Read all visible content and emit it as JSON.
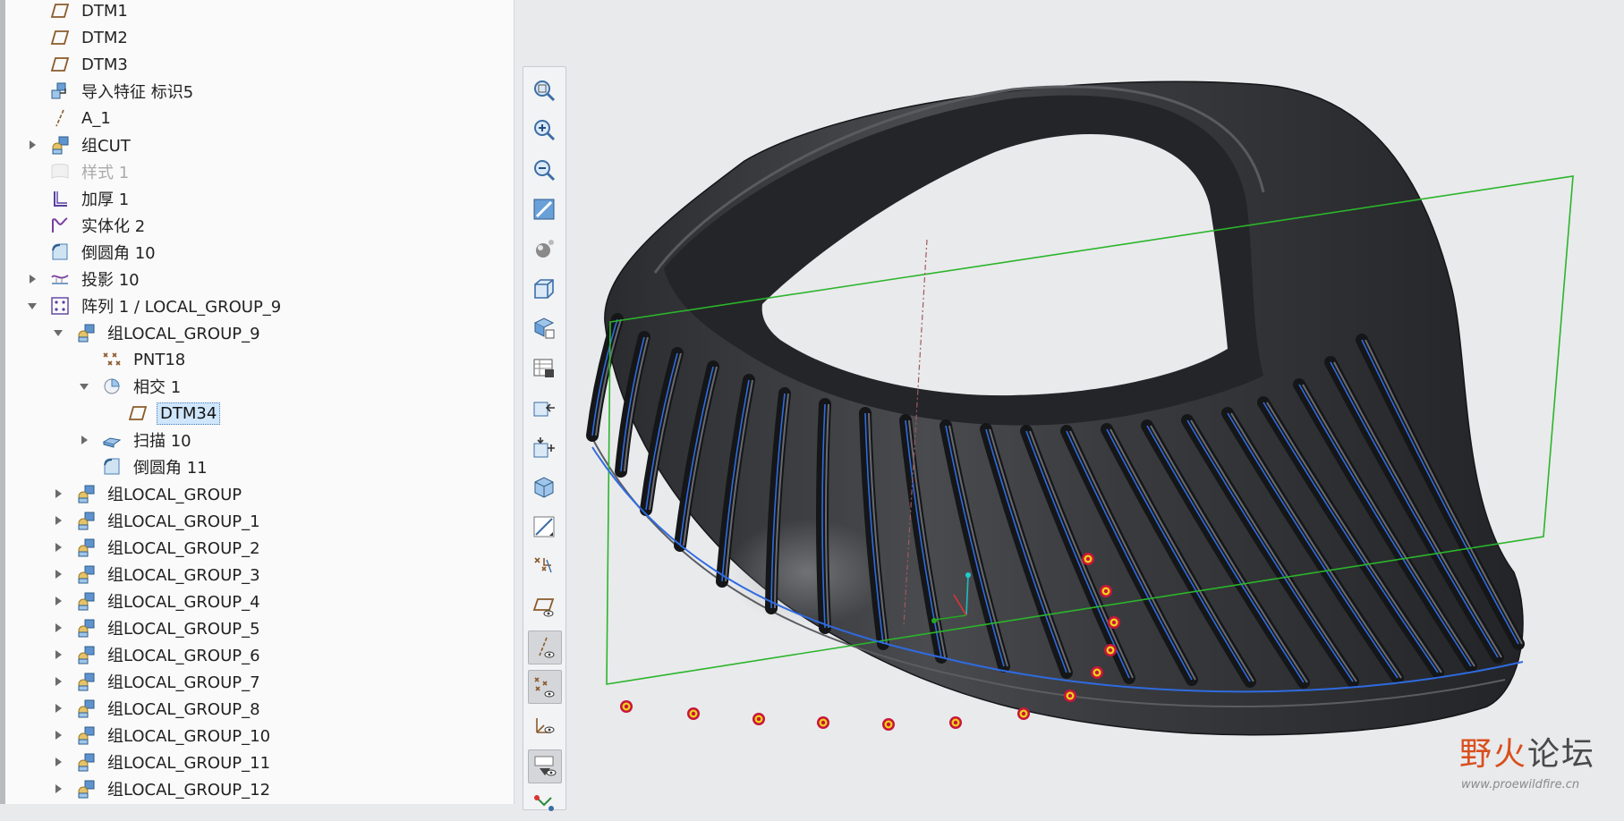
{
  "tree": {
    "items": [
      {
        "label": "DTM1",
        "icon": "datum-plane-icon",
        "expander": "none",
        "indent": 0
      },
      {
        "label": "DTM2",
        "icon": "datum-plane-icon",
        "expander": "none",
        "indent": 0
      },
      {
        "label": "DTM3",
        "icon": "datum-plane-icon",
        "expander": "none",
        "indent": 0
      },
      {
        "label": "导入特征 标识5",
        "icon": "import-feature-icon",
        "expander": "none",
        "indent": 0
      },
      {
        "label": "A_1",
        "icon": "datum-axis-icon",
        "expander": "none",
        "indent": 0
      },
      {
        "label": "组CUT",
        "icon": "group-icon",
        "expander": "collapsed",
        "indent": 0
      },
      {
        "label": "样式 1",
        "icon": "style-icon",
        "expander": "none",
        "indent": 0,
        "state": "suppressed"
      },
      {
        "label": "加厚 1",
        "icon": "thicken-icon",
        "expander": "none",
        "indent": 0
      },
      {
        "label": "实体化 2",
        "icon": "solidify-icon",
        "expander": "none",
        "indent": 0
      },
      {
        "label": "倒圆角 10",
        "icon": "round-icon",
        "expander": "none",
        "indent": 0
      },
      {
        "label": "投影 10",
        "icon": "projection-icon",
        "expander": "collapsed",
        "indent": 0
      },
      {
        "label": "阵列 1 / LOCAL_GROUP_9",
        "icon": "pattern-icon",
        "expander": "expanded",
        "indent": 0
      },
      {
        "label": "组LOCAL_GROUP_9",
        "icon": "group-icon",
        "expander": "expanded",
        "indent": 1
      },
      {
        "label": "PNT18",
        "icon": "datum-point-icon",
        "expander": "none",
        "indent": 2
      },
      {
        "label": "相交 1",
        "icon": "intersect-icon",
        "expander": "expanded",
        "indent": 2
      },
      {
        "label": "DTM34",
        "icon": "datum-plane-icon",
        "expander": "none",
        "indent": 3,
        "state": "selected"
      },
      {
        "label": "扫描 10",
        "icon": "sweep-icon",
        "expander": "collapsed",
        "indent": 2
      },
      {
        "label": "倒圆角 11",
        "icon": "round-icon",
        "expander": "none",
        "indent": 2
      },
      {
        "label": "组LOCAL_GROUP",
        "icon": "group-icon",
        "expander": "collapsed",
        "indent": 1
      },
      {
        "label": "组LOCAL_GROUP_1",
        "icon": "group-icon",
        "expander": "collapsed",
        "indent": 1
      },
      {
        "label": "组LOCAL_GROUP_2",
        "icon": "group-icon",
        "expander": "collapsed",
        "indent": 1
      },
      {
        "label": "组LOCAL_GROUP_3",
        "icon": "group-icon",
        "expander": "collapsed",
        "indent": 1
      },
      {
        "label": "组LOCAL_GROUP_4",
        "icon": "group-icon",
        "expander": "collapsed",
        "indent": 1
      },
      {
        "label": "组LOCAL_GROUP_5",
        "icon": "group-icon",
        "expander": "collapsed",
        "indent": 1
      },
      {
        "label": "组LOCAL_GROUP_6",
        "icon": "group-icon",
        "expander": "collapsed",
        "indent": 1
      },
      {
        "label": "组LOCAL_GROUP_7",
        "icon": "group-icon",
        "expander": "collapsed",
        "indent": 1
      },
      {
        "label": "组LOCAL_GROUP_8",
        "icon": "group-icon",
        "expander": "collapsed",
        "indent": 1
      },
      {
        "label": "组LOCAL_GROUP_10",
        "icon": "group-icon",
        "expander": "collapsed",
        "indent": 1
      },
      {
        "label": "组LOCAL_GROUP_11",
        "icon": "group-icon",
        "expander": "collapsed",
        "indent": 1
      },
      {
        "label": "组LOCAL_GROUP_12",
        "icon": "group-icon",
        "expander": "collapsed",
        "indent": 1
      }
    ]
  },
  "toolbar": {
    "buttons": [
      {
        "name": "refit-icon"
      },
      {
        "name": "zoom-in-icon"
      },
      {
        "name": "zoom-out-icon"
      },
      {
        "name": "repaint-icon"
      },
      {
        "name": "display-style-icon"
      },
      {
        "name": "saved-orientations-icon"
      },
      {
        "name": "view-manager-icon"
      },
      {
        "name": "perspective-icon"
      },
      {
        "name": "section-next-icon"
      },
      {
        "name": "section-add-icon"
      },
      {
        "name": "appearance-icon"
      },
      {
        "name": "sketch-view-icon"
      },
      {
        "name": "annotation-display-icon"
      },
      {
        "name": "plane-display-icon"
      },
      {
        "name": "axis-display-icon",
        "active": true
      },
      {
        "name": "point-display-icon",
        "active": true
      },
      {
        "name": "csys-display-icon"
      },
      {
        "name": "spin-center-icon",
        "active": true
      },
      {
        "name": "model-tree-toggle-icon"
      }
    ]
  },
  "watermark": {
    "title_a": "野",
    "title_b": "火",
    "title_c": "论坛",
    "url": "www.proewildfire.cn"
  },
  "colors": {
    "model": "#3c3d40",
    "model_dark": "#1b1c1e",
    "curve": "#2f6be0",
    "datum_plane": "#2bb52b",
    "point_marker": "#f0d21a",
    "point_ring": "#c8163a",
    "selection": "#cfe6fb"
  }
}
